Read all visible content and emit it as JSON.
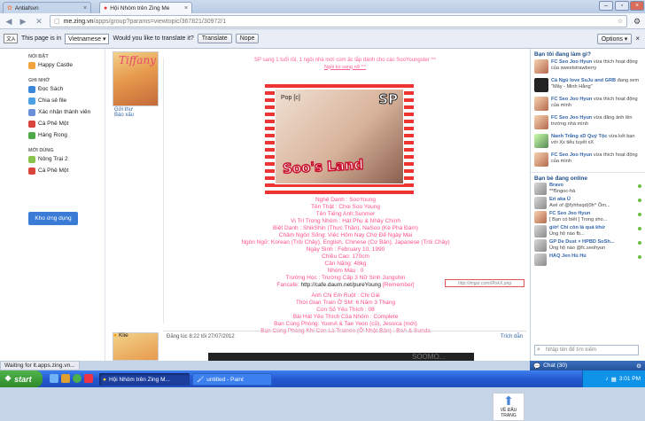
{
  "browser": {
    "tabs": [
      {
        "label": "Antiafsvn"
      },
      {
        "label": "Hội Nhóm trên Zing Me"
      }
    ],
    "url_host": "me.zing.vn",
    "url_path": "/apps/group?params=viewtopic/367821/30972/1"
  },
  "translate_bar": {
    "prefix": "This page is in",
    "language": "Vietnamese",
    "question": "Would you like to translate it?",
    "translate_label": "Translate",
    "nope_label": "Nope",
    "options_label": "Options"
  },
  "leftnav": {
    "sections": [
      {
        "heading": "NỔI BẬT",
        "items": [
          "Happy Castle"
        ]
      },
      {
        "heading": "GHI NHỚ",
        "items": [
          "Đọc Sách",
          "Chia sẻ file",
          "Xác nhận thành viên",
          "Cà Phê Một",
          "Hàng Rong"
        ]
      },
      {
        "heading": "MỚI DÙNG",
        "items": [
          "Nông Trại 2",
          "Cà Phê Một"
        ]
      }
    ],
    "app_button": "Kho ứng dụng"
  },
  "post": {
    "avatar_text": "Tiffany",
    "side_links": [
      "Gửi thư",
      "Báo xấu"
    ],
    "intro": "SP sang 1 tuổi rồi, 1 ngôi nhà mới cùm ấc lắp dành cho các SooYoungster ^^",
    "intro2": "Ngồi ko sang nữ ^^",
    "photo_label": "Pop [c]",
    "photo_sp": "SP",
    "photo_logo": "Soo's Land",
    "profile_lines": [
      "Nghệ Danh : SooYoung",
      "Tên Thật : Choi Soo Young",
      "Tên Tiếng Anh:Sunmer",
      "Vị Trí Trong Nhóm : Hát Phụ & Nhảy Chính",
      "Biệt Danh : ShikShin (Thực Thần), NaSoo (Kè Phá Đám)",
      "Châm Ngôn Sống: Việc Hôm Nay Chớ Để Ngày Mai",
      "Ngôn Ngữ: Korean (Trôi Chảy), English, Chinese (Cơ Bản), Japanese (Trôi Chảy)",
      "Ngày Sinh : February 10, 1990",
      "Chiều Cao: 170cm",
      "Cân Nặng: 48kg",
      "Nhóm Máu : 0",
      "Trường Học : Trường Cấp 3 Nữ Sinh Jungshin"
    ],
    "fancafe_label": "Fancafe:",
    "fancafe_url": "http://cafe.daum.net/pureYoung",
    "fancafe_remember": "[Remember]",
    "stamp_text": "http://imgur.com/IRxkX.png",
    "profile_lines2": [
      "Anh Chị Em Ruột : Chị Gái",
      "Thời Gian Train Ở SM: 6 Năm 3 Tháng",
      "Con Số Yêu Thích : 08",
      "Bài Hát Yêu Thích Của Nhóm : Complete",
      "Bạn Cùng Phòng: YoonA & Tae Yeon (cũ), Jessica (mới)",
      "Bạn Cùng Phòng Khi Còn Là Trainee (Ở Nhật Bản) : BoA & Sunda"
    ],
    "posted_date": "Đăng lúc 8:22 tối 27/07/2012",
    "reply_label": "Trích dẫn",
    "next_user": "Klie",
    "dark_text": "SOOMO..."
  },
  "to_top": "VỀ ĐẦU TRANG",
  "right": {
    "activity_heading": "Bạn tôi đang làm gì?",
    "activity": [
      {
        "name": "FC Seo Joo Hyun",
        "text": "vừa thích hoạt động của sweetstrawberry"
      },
      {
        "name": "Cá Ngủ love SuJu and GRB",
        "text": "đang xem \"Mây - Minh Hằng\""
      },
      {
        "name": "FC Seo Joo Hyun",
        "text": "vừa thích hoạt động của mình"
      },
      {
        "name": "FC Seo Joo Hyun",
        "text": "vừa đăng ảnh lên trường nhà mình"
      },
      {
        "name": "Nanh Trắng xD Quý Tộc",
        "text": "vừa kết bạn với Xx tiểu tuyết xX"
      },
      {
        "name": "FC Seo Joo Hyun",
        "text": "vừa thích hoạt động của mình"
      }
    ],
    "online_heading": "Bạn bè đang online",
    "online": [
      {
        "name": "Bravo",
        "text": "**f5ngoc-hà"
      },
      {
        "name": "Eri aka Ü",
        "text": "Avé of @fyhhsqd(0h^ Ôm..."
      },
      {
        "name": "FC Seo Joo Hyun",
        "text": "[ Bạn có biết ] Trong sho..."
      },
      {
        "name": "giờ! Chỉ còn là quá khứ",
        "text": "Ủng hộ nào fb..."
      },
      {
        "name": "GP De Dust × HPBD SoSh...",
        "text": "Ủng hộ nào @fc.seohyun"
      },
      {
        "name": "HAQ Jen Hú Hú",
        "text": ""
      }
    ],
    "search_placeholder": "Nhập tên để tìm kiếm",
    "chat_label": "Chat (30)"
  },
  "status_text": "Waiting for lt.apps.zing.vn...",
  "taskbar": {
    "start": "start",
    "tasks": [
      "Hội Nhóm trên Zing M...",
      "untitled - Paint"
    ],
    "clock": "3:01 PM"
  }
}
